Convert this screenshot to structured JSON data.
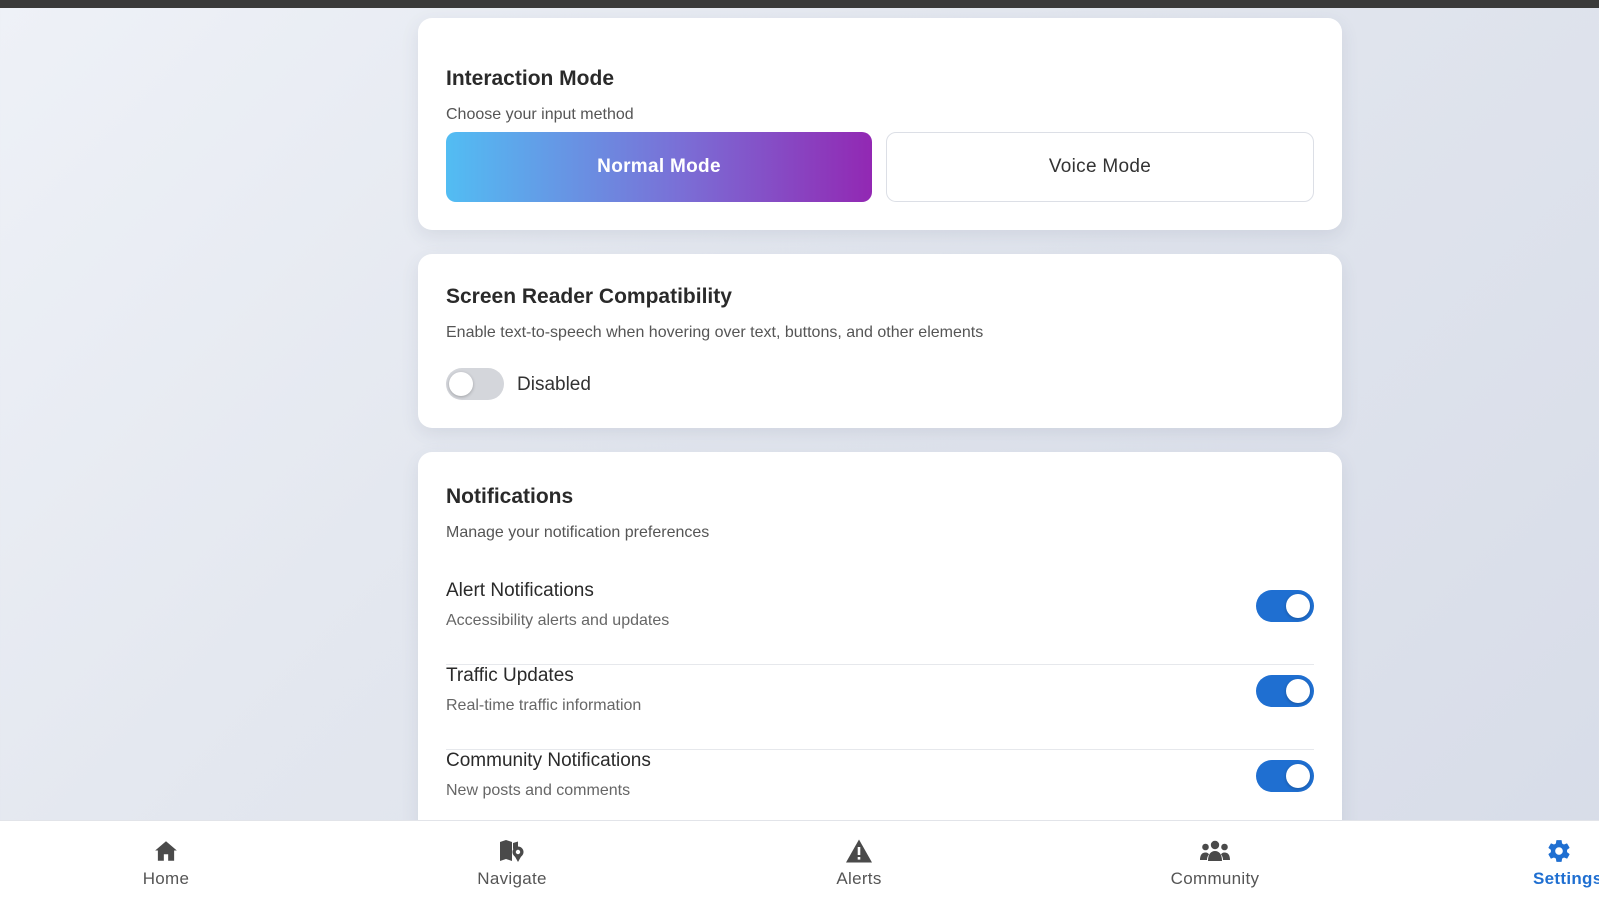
{
  "interaction_mode": {
    "title": "Interaction Mode",
    "subtitle": "Choose your input method",
    "normal_label": "Normal Mode",
    "voice_label": "Voice Mode",
    "selected": "Normal Mode"
  },
  "screen_reader": {
    "title": "Screen Reader Compatibility",
    "subtitle": "Enable text-to-speech when hovering over text, buttons, and other elements",
    "state_label": "Disabled",
    "enabled": false
  },
  "notifications": {
    "title": "Notifications",
    "subtitle": "Manage your notification preferences",
    "items": [
      {
        "name": "Alert Notifications",
        "description": "Accessibility alerts and updates",
        "enabled": true
      },
      {
        "name": "Traffic Updates",
        "description": "Real-time traffic information",
        "enabled": true
      },
      {
        "name": "Community Notifications",
        "description": "New posts and comments",
        "enabled": true
      }
    ]
  },
  "bottom_nav": {
    "items": [
      {
        "label": "Home",
        "icon": "home-icon"
      },
      {
        "label": "Navigate",
        "icon": "map-pin-icon"
      },
      {
        "label": "Alerts",
        "icon": "warning-icon"
      },
      {
        "label": "Community",
        "icon": "people-icon"
      },
      {
        "label": "Settings",
        "icon": "gear-icon"
      }
    ],
    "active": "Settings"
  },
  "colors": {
    "accent": "#1f6fd1",
    "gradient_start": "#52bdf3",
    "gradient_end": "#9228b3"
  }
}
